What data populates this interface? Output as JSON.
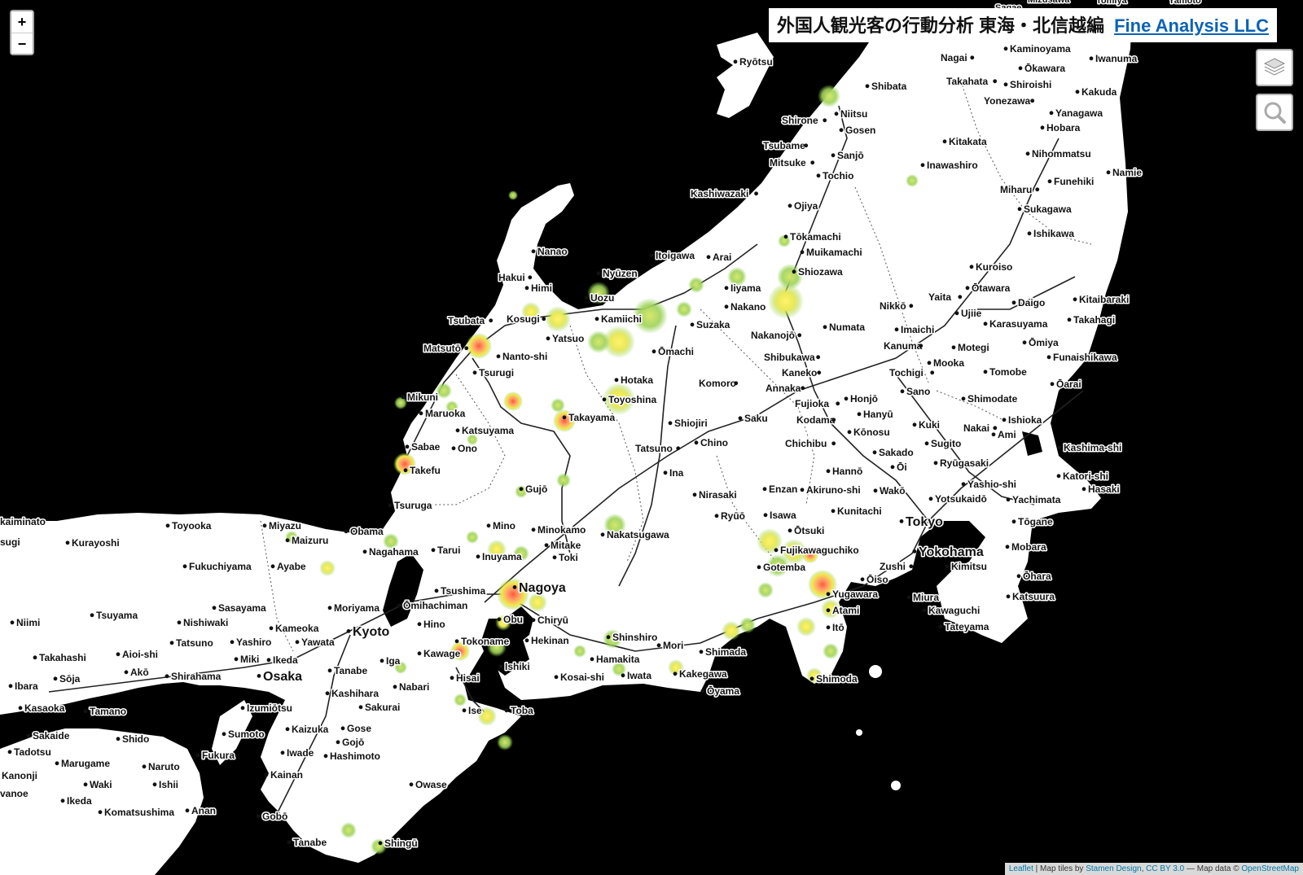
{
  "title": {
    "text": "外国人観光客の行動分析 東海・北信越編",
    "company": "Fine Analysis LLC"
  },
  "zoom": {
    "in_label": "+",
    "out_label": "−"
  },
  "controls": {
    "layers_icon": "layers-icon",
    "search_icon": "search-icon"
  },
  "attribution": {
    "leaflet": "Leaflet",
    "sep": " | Map tiles by ",
    "stamen": "Stamen Design",
    "comma": ", ",
    "ccby": "CC BY 3.0",
    "mapdata": " — Map data © ",
    "osm": "OpenStreetMap"
  },
  "colors": {
    "land": "#ffffff",
    "sea": "#000000",
    "heat_low": "#8fd14f",
    "heat_mid": "#f2e84b",
    "heat_high": "#f05a3a"
  },
  "cities": [
    {
      "name": "Ryōtsu"
    },
    {
      "name": "Shibata"
    },
    {
      "name": "Niitsu"
    },
    {
      "name": "Shirone"
    },
    {
      "name": "Gosen"
    },
    {
      "name": "Tsubame"
    },
    {
      "name": "Sanjō"
    },
    {
      "name": "Mitsuke"
    },
    {
      "name": "Tochio"
    },
    {
      "name": "Kashiwazaki"
    },
    {
      "name": "Ojiya"
    },
    {
      "name": "Tōkamachi"
    },
    {
      "name": "Muikamachi"
    },
    {
      "name": "Shiozawa"
    },
    {
      "name": "Nanao"
    },
    {
      "name": "Hakui"
    },
    {
      "name": "Himi"
    },
    {
      "name": "Itoigawa"
    },
    {
      "name": "Arai"
    },
    {
      "name": "Nyūzen"
    },
    {
      "name": "Uozu"
    },
    {
      "name": "Kamiichi"
    },
    {
      "name": "Tsubata"
    },
    {
      "name": "Kosugi"
    },
    {
      "name": "Yatsuo"
    },
    {
      "name": "Iiyama"
    },
    {
      "name": "Nakano"
    },
    {
      "name": "Suzaka"
    },
    {
      "name": "Ōmachi"
    },
    {
      "name": "Matsutō"
    },
    {
      "name": "Nanto-shi"
    },
    {
      "name": "Tsurugi"
    },
    {
      "name": "Mikuni"
    },
    {
      "name": "Maruoka"
    },
    {
      "name": "Katsuyama"
    },
    {
      "name": "Sabae"
    },
    {
      "name": "Ono"
    },
    {
      "name": "Takefu"
    },
    {
      "name": "Hotaka"
    },
    {
      "name": "Toyoshina"
    },
    {
      "name": "Takayama"
    },
    {
      "name": "Shiojiri"
    },
    {
      "name": "Komoro"
    },
    {
      "name": "Saku"
    },
    {
      "name": "Chino"
    },
    {
      "name": "Tatsuno"
    },
    {
      "name": "Ina"
    },
    {
      "name": "Tsuruga"
    },
    {
      "name": "Gujō"
    },
    {
      "name": "Nakatsugawa"
    },
    {
      "name": "Numata"
    },
    {
      "name": "Nakanojō"
    },
    {
      "name": "Shibukawa"
    },
    {
      "name": "Kaneko"
    },
    {
      "name": "Annaka"
    },
    {
      "name": "Fujioka"
    },
    {
      "name": "Kodama"
    },
    {
      "name": "Honjō"
    },
    {
      "name": "Hanyū"
    },
    {
      "name": "Kōnosu"
    },
    {
      "name": "Chichibu"
    },
    {
      "name": "Nagai"
    },
    {
      "name": "Kaminoyama"
    },
    {
      "name": "Ōkawara"
    },
    {
      "name": "Iwanuma"
    },
    {
      "name": "Takahata"
    },
    {
      "name": "Shiroishi"
    },
    {
      "name": "Kakuda"
    },
    {
      "name": "Yonezawa"
    },
    {
      "name": "Yanagawa"
    },
    {
      "name": "Hobara"
    },
    {
      "name": "Kitakata"
    },
    {
      "name": "Nihommatsu"
    },
    {
      "name": "Inawashiro"
    },
    {
      "name": "Namie"
    },
    {
      "name": "Funehiki"
    },
    {
      "name": "Miharu"
    },
    {
      "name": "Sukagawa"
    },
    {
      "name": "Ishikawa"
    },
    {
      "name": "Kuroiso"
    },
    {
      "name": "Ōtawara"
    },
    {
      "name": "Yaita"
    },
    {
      "name": "Daigo"
    },
    {
      "name": "Kitaibaraki"
    },
    {
      "name": "Takahagi"
    },
    {
      "name": "Nikkō"
    },
    {
      "name": "Ujiie"
    },
    {
      "name": "Karasuyama"
    },
    {
      "name": "Imaichi"
    },
    {
      "name": "Kanuma"
    },
    {
      "name": "Motegi"
    },
    {
      "name": "Ōmiya"
    },
    {
      "name": "Funaishikawa"
    },
    {
      "name": "Tochigi"
    },
    {
      "name": "Mooka"
    },
    {
      "name": "Tomobe"
    },
    {
      "name": "Ōarai"
    },
    {
      "name": "Sano"
    },
    {
      "name": "Shimodate"
    },
    {
      "name": "Kuki"
    },
    {
      "name": "Nakai"
    },
    {
      "name": "Ishioka"
    },
    {
      "name": "Sakado"
    },
    {
      "name": "Sugito"
    },
    {
      "name": "Ami"
    },
    {
      "name": "Ōi"
    },
    {
      "name": "Kashima-shi"
    },
    {
      "name": "Hannō"
    },
    {
      "name": "Ryūgasaki"
    },
    {
      "name": "Wakō"
    },
    {
      "name": "Yashio-shi"
    },
    {
      "name": "Katori-shi"
    },
    {
      "name": "Nirasaki"
    },
    {
      "name": "Enzan"
    },
    {
      "name": "Akiruno-shi"
    },
    {
      "name": "Hasaki"
    },
    {
      "name": "Ryūō"
    },
    {
      "name": "Isawa"
    },
    {
      "name": "Kunitachi"
    },
    {
      "name": "Yotsukaidō"
    },
    {
      "name": "Yachimata"
    },
    {
      "name": "Tokyo"
    },
    {
      "name": "Tōgane"
    },
    {
      "name": "Ōtsuki"
    },
    {
      "name": "Fujikawaguchiko"
    },
    {
      "name": "Yokohama"
    },
    {
      "name": "Mobara"
    },
    {
      "name": "Gotemba"
    },
    {
      "name": "Zushi"
    },
    {
      "name": "Kimitsu"
    },
    {
      "name": "Ōiso"
    },
    {
      "name": "Ōhara"
    },
    {
      "name": "Miura"
    },
    {
      "name": "Yugawara"
    },
    {
      "name": "Katsuura"
    },
    {
      "name": "Atami"
    },
    {
      "name": "Kawaguchi"
    },
    {
      "name": "Itō"
    },
    {
      "name": "Tateyama"
    },
    {
      "name": "Shimoda"
    },
    {
      "name": "Shimada"
    },
    {
      "name": "Kakegawa"
    },
    {
      "name": "Ōyama"
    },
    {
      "name": "Mori"
    },
    {
      "name": "Iwata"
    },
    {
      "name": "Hamakita"
    },
    {
      "name": "Kosai-shi"
    },
    {
      "name": "Shinshiro"
    },
    {
      "name": "Hekinan"
    },
    {
      "name": "Chiryū"
    },
    {
      "name": "Obu"
    },
    {
      "name": "Tokoname"
    },
    {
      "name": "Ishiki"
    },
    {
      "name": "Nagoya"
    },
    {
      "name": "Tsushima"
    },
    {
      "name": "Inuyama"
    },
    {
      "name": "Toki"
    },
    {
      "name": "Mitake"
    },
    {
      "name": "Minokamo"
    },
    {
      "name": "Mino"
    },
    {
      "name": "Tarui"
    },
    {
      "name": "Ōmihachiman"
    },
    {
      "name": "Hino"
    },
    {
      "name": "Kameoka"
    },
    {
      "name": "Kyoto"
    },
    {
      "name": "Yawata"
    },
    {
      "name": "Moriyama"
    },
    {
      "name": "Nagahama"
    },
    {
      "name": "Obama"
    },
    {
      "name": "Miyazu"
    },
    {
      "name": "Maizuru"
    },
    {
      "name": "Ayabe"
    },
    {
      "name": "Fukuchiyama"
    },
    {
      "name": "Toyooka"
    },
    {
      "name": "Kurayoshi"
    },
    {
      "name": "Sasayama"
    },
    {
      "name": "Nishiwaki"
    },
    {
      "name": "Tsuyama"
    },
    {
      "name": "Niimi"
    },
    {
      "name": "Tatsuno"
    },
    {
      "name": "Yashiro"
    },
    {
      "name": "Aioi-shi"
    },
    {
      "name": "Miki"
    },
    {
      "name": "Ikeda"
    },
    {
      "name": "Takahashi"
    },
    {
      "name": "Akō"
    },
    {
      "name": "Sōja"
    },
    {
      "name": "Shirahama"
    },
    {
      "name": "Osaka"
    },
    {
      "name": "Ibara"
    },
    {
      "name": "Tanabe"
    },
    {
      "name": "Iga"
    },
    {
      "name": "Kawage"
    },
    {
      "name": "Hisai"
    },
    {
      "name": "Nabari"
    },
    {
      "name": "Kashihara"
    },
    {
      "name": "Sakurai"
    },
    {
      "name": "Ise"
    },
    {
      "name": "Toba"
    },
    {
      "name": "Izumiōtsu"
    },
    {
      "name": "Kasaoka"
    },
    {
      "name": "Tamano"
    },
    {
      "name": "Kaizuka"
    },
    {
      "name": "Gose"
    },
    {
      "name": "Gojō"
    },
    {
      "name": "Sumoto"
    },
    {
      "name": "Shido"
    },
    {
      "name": "Sakaide"
    },
    {
      "name": "Tadotsu"
    },
    {
      "name": "Iwade"
    },
    {
      "name": "Hashimoto"
    },
    {
      "name": "Fukura"
    },
    {
      "name": "Naruto"
    },
    {
      "name": "Marugame"
    },
    {
      "name": "Kanonji"
    },
    {
      "name": "Kainan"
    },
    {
      "name": "Waki"
    },
    {
      "name": "Ishii"
    },
    {
      "name": "Owase"
    },
    {
      "name": "Ikeda"
    },
    {
      "name": "Anan"
    },
    {
      "name": "Komatsushima"
    },
    {
      "name": "Gobō"
    },
    {
      "name": "Tanabe"
    },
    {
      "name": "Shingū"
    },
    {
      "name": "kaiminato"
    },
    {
      "name": "sugi"
    },
    {
      "name": "vanoe"
    },
    {
      "name": "Mizusawa"
    },
    {
      "name": "Tomiya"
    },
    {
      "name": "Yamoto"
    },
    {
      "name": "Sagae"
    }
  ]
}
